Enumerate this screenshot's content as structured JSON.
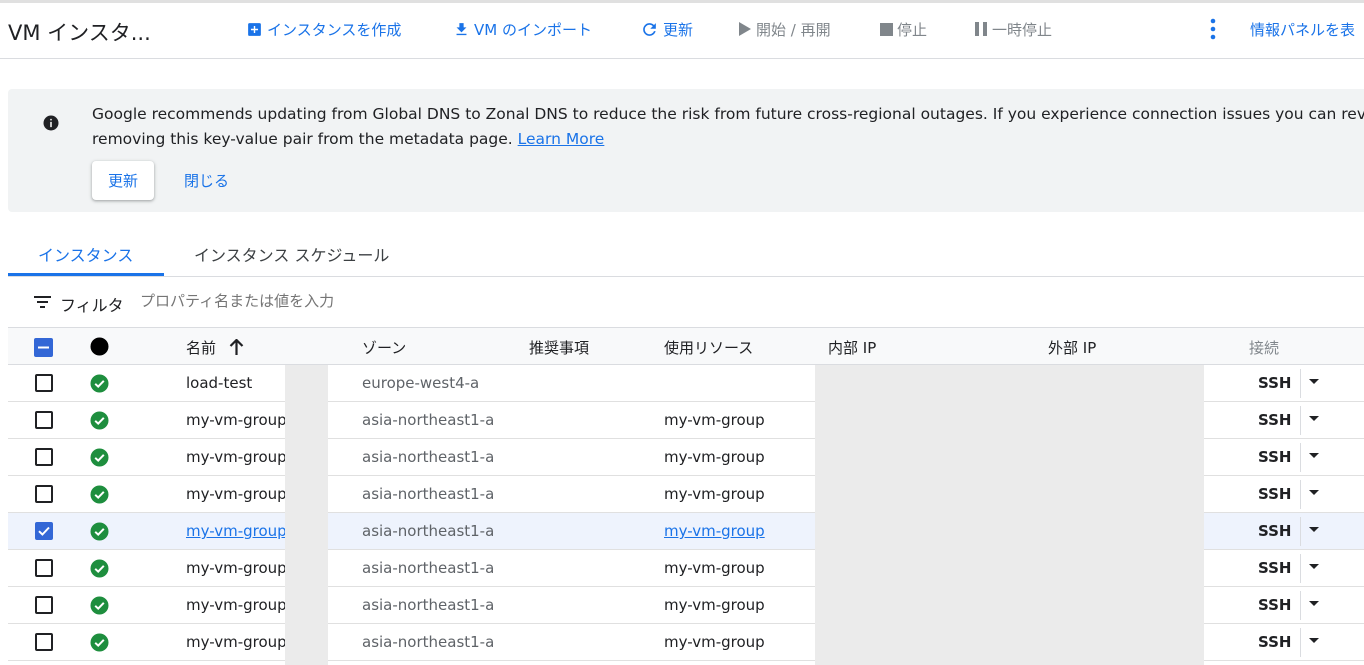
{
  "header": {
    "title": "VM インスタ...",
    "actions": {
      "create": "インスタンスを作成",
      "import": "VM のインポート",
      "refresh": "更新",
      "start": "開始 / 再開",
      "stop": "停止",
      "suspend": "一時停止",
      "info_panel": "情報パネルを表"
    }
  },
  "banner": {
    "line1": "Google recommends updating from Global DNS to Zonal DNS to reduce the risk from future cross-regional outages. If you experience connection issues you can revert this updat",
    "line2": "removing this key-value pair from the metadata page. ",
    "learn_more": "Learn More",
    "update_button": "更新",
    "close_button": "閉じる"
  },
  "tabs": {
    "instances": "インスタンス",
    "schedules": "インスタンス スケジュール"
  },
  "filter": {
    "label": "フィルタ",
    "placeholder": "プロパティ名または値を入力"
  },
  "table": {
    "columns": {
      "name": "名前",
      "zone": "ゾーン",
      "recommendations": "推奨事項",
      "in_use_by": "使用リソース",
      "internal_ip": "内部 IP",
      "external_ip": "外部 IP",
      "connect": "接続"
    },
    "rows": [
      {
        "name": "load-test",
        "zone": "europe-west4-a",
        "in_use_by": "",
        "selected": false,
        "connect": "SSH"
      },
      {
        "name": "my-vm-group-",
        "zone": "asia-northeast1-a",
        "in_use_by": "my-vm-group",
        "selected": false,
        "connect": "SSH"
      },
      {
        "name": "my-vm-group-",
        "zone": "asia-northeast1-a",
        "in_use_by": "my-vm-group",
        "selected": false,
        "connect": "SSH"
      },
      {
        "name": "my-vm-group-",
        "zone": "asia-northeast1-a",
        "in_use_by": "my-vm-group",
        "selected": false,
        "connect": "SSH"
      },
      {
        "name": "my-vm-group-",
        "zone": "asia-northeast1-a",
        "in_use_by": "my-vm-group",
        "selected": true,
        "connect": "SSH"
      },
      {
        "name": "my-vm-group-",
        "zone": "asia-northeast1-a",
        "in_use_by": "my-vm-group",
        "selected": false,
        "connect": "SSH"
      },
      {
        "name": "my-vm-group-",
        "zone": "asia-northeast1-a",
        "in_use_by": "my-vm-group",
        "selected": false,
        "connect": "SSH"
      },
      {
        "name": "my-vm-group-",
        "zone": "asia-northeast1-a",
        "in_use_by": "my-vm-group",
        "selected": false,
        "connect": "SSH"
      }
    ]
  },
  "colors": {
    "accent": "#1a73e8",
    "status_ok": "#1e8e3e",
    "checkbox": "#3367d6"
  }
}
